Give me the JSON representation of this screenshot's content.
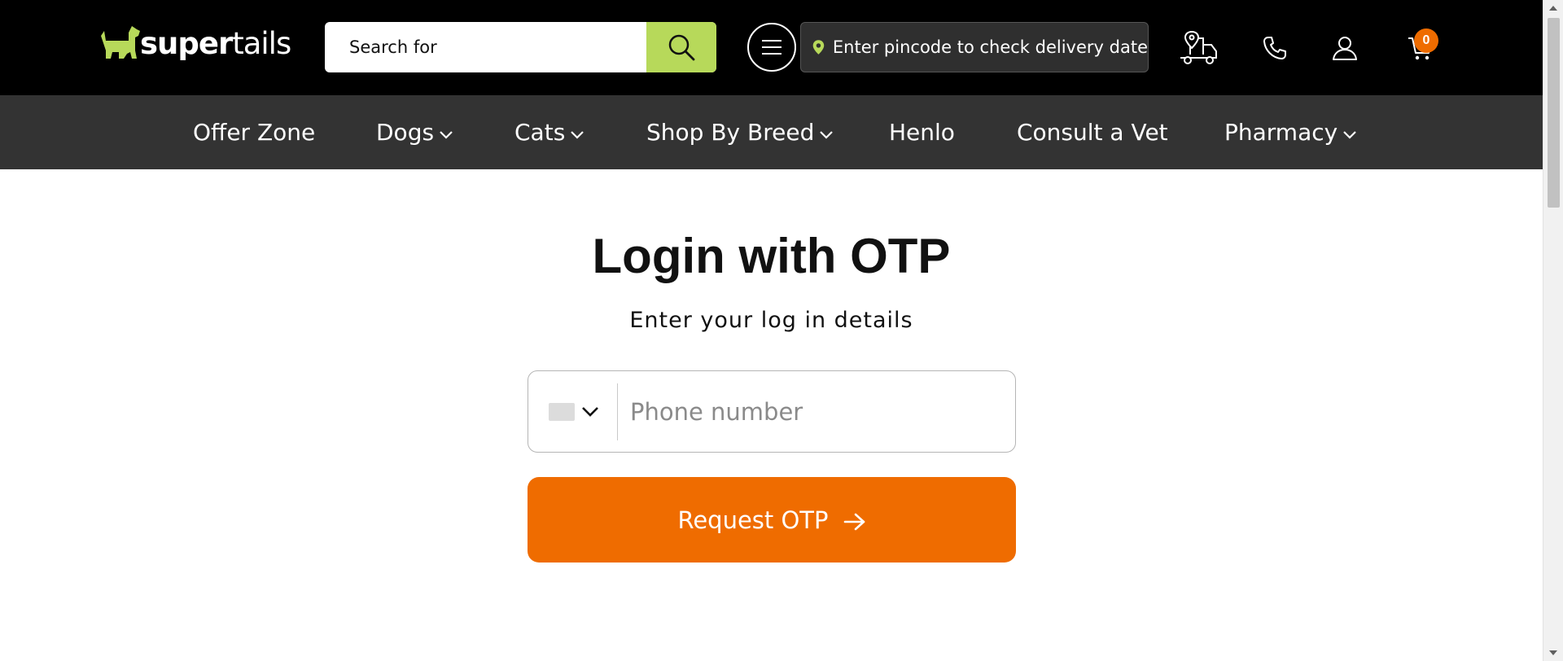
{
  "header": {
    "brand": {
      "bold": "super",
      "light": "tails",
      "color": "#b7d95a"
    },
    "search": {
      "placeholder": "Search for"
    },
    "pincode": {
      "text": "Enter pincode to check delivery date"
    },
    "cart": {
      "count": "0"
    },
    "icons": [
      "search-icon",
      "menu-icon",
      "location-pin-icon",
      "delivery-truck-icon",
      "phone-icon",
      "user-icon",
      "cart-icon"
    ]
  },
  "nav": {
    "items": [
      {
        "label": "Offer Zone",
        "dropdown": false
      },
      {
        "label": "Dogs",
        "dropdown": true
      },
      {
        "label": "Cats",
        "dropdown": true
      },
      {
        "label": "Shop By Breed",
        "dropdown": true
      },
      {
        "label": "Henlo",
        "dropdown": false
      },
      {
        "label": "Consult a Vet",
        "dropdown": false
      },
      {
        "label": "Pharmacy",
        "dropdown": true
      }
    ]
  },
  "login": {
    "title": "Login with OTP",
    "subtitle": "Enter your log in details",
    "phone_placeholder": "Phone number",
    "submit_label": "Request OTP"
  },
  "colors": {
    "header_bg": "#000000",
    "nav_bg": "#333333",
    "accent_green": "#b7d95a",
    "accent_orange": "#ef6c00"
  }
}
